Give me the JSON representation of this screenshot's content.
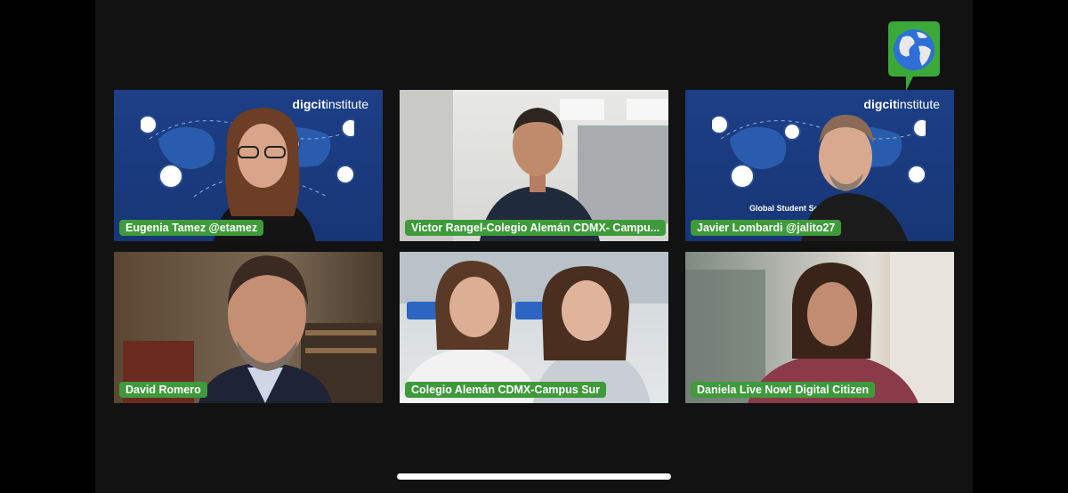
{
  "app": {
    "title": "Video call gallery view"
  },
  "branding": {
    "logo_text_bold": "digcit",
    "logo_text": "institute",
    "banner_text": "Global Student Series"
  },
  "participants": [
    {
      "name": "Eugenia Tamez @etamez",
      "background": "brand"
    },
    {
      "name": "Victor Rangel-Colegio Alemán CDMX- Campu...",
      "background": "office"
    },
    {
      "name": "Javier Lombardi @jalito27",
      "background": "brand"
    },
    {
      "name": "David Romero",
      "background": "room"
    },
    {
      "name": "Colegio Alemán CDMX-Campus Sur",
      "background": "classroom"
    },
    {
      "name": "Daniela Live Now! Digital Citizen",
      "background": "blur"
    }
  ],
  "colors": {
    "name_label": "#3f9a3b",
    "brand_bg": "#1d3f86",
    "screen_bg": "#121212"
  },
  "icons": {
    "badge": "globe-speech-bubble-icon",
    "home_indicator": "home-indicator"
  }
}
